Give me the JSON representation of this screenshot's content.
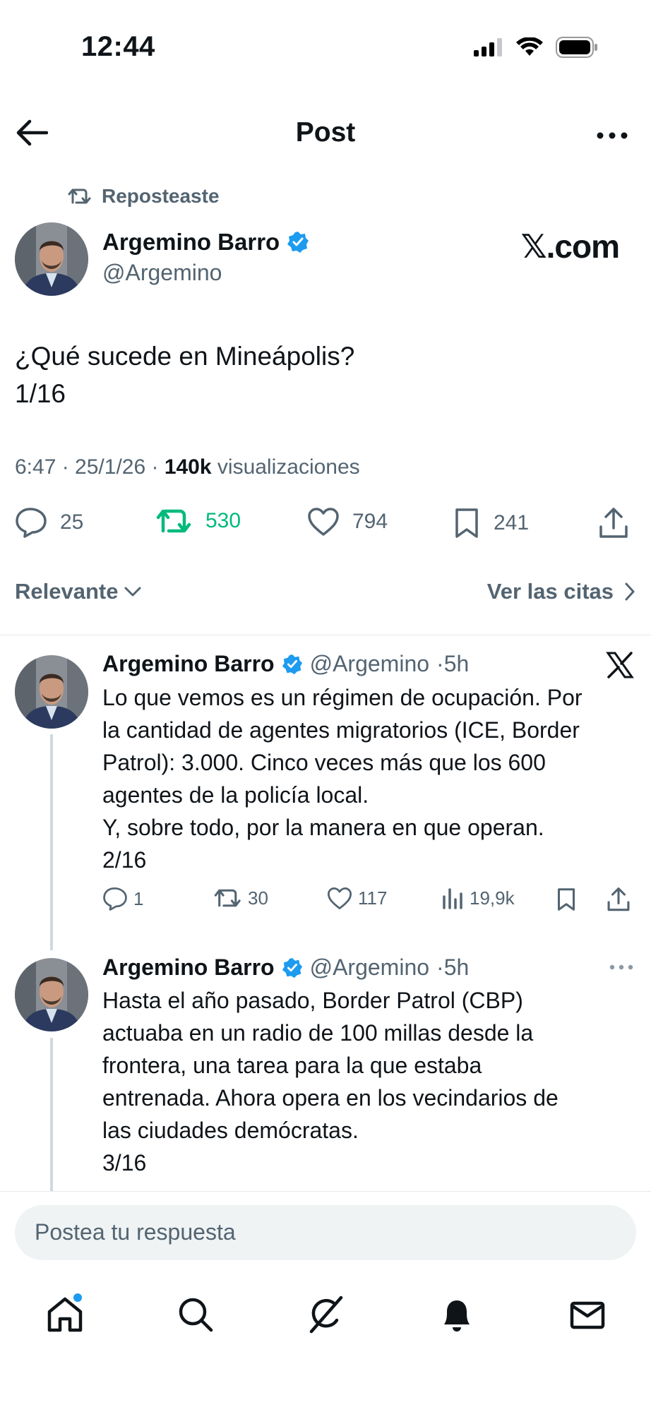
{
  "status_bar": {
    "time": "12:44"
  },
  "header": {
    "title": "Post"
  },
  "repost": {
    "label": "Reposteaste"
  },
  "post": {
    "author_name": "Argemino Barro",
    "author_handle": "@Argemino",
    "watermark": "𝕏.com",
    "text_line1": "¿Qué sucede en Mineápolis?",
    "text_line2": "1/16",
    "meta_time": "6:47 · 25/1/26 · ",
    "meta_views_count": "140k",
    "meta_views_label": " visualizaciones",
    "stats": {
      "replies": "25",
      "reposts": "530",
      "likes": "794",
      "bookmarks": "241"
    }
  },
  "sort": {
    "relevance_label": "Relevante",
    "quotes_label": "Ver las citas"
  },
  "replies": [
    {
      "name": "Argemino Barro",
      "handle": "@Argemino",
      "time": "·5h",
      "lines": [
        "Lo que vemos es un régimen de ocupación. Por",
        "la cantidad de agentes migratorios (ICE, Border",
        "Patrol): 3.000. Cinco veces más que los 600",
        "agentes de la policía local.",
        "Y, sobre todo, por la manera en que operan.",
        "2/16"
      ],
      "stats": {
        "replies": "1",
        "reposts": "30",
        "likes": "117",
        "views": "19,9k"
      }
    },
    {
      "name": "Argemino Barro",
      "handle": "@Argemino",
      "time": "·5h",
      "lines": [
        "Hasta el año pasado, Border Patrol (CBP)",
        "actuaba en un radio de 100 millas desde la",
        "frontera, una tarea para la que estaba",
        "entrenada. Ahora opera en los vecindarios de",
        "las ciudades demócratas.",
        "3/16"
      ]
    }
  ],
  "composer": {
    "placeholder": "Postea tu respuesta"
  },
  "colors": {
    "accent": "#1d9bf0",
    "repost_green": "#00ba7c",
    "muted": "#536471"
  },
  "icons": [
    "back-arrow-icon",
    "more-icon",
    "repost-icon",
    "verified-badge-icon",
    "reply-icon",
    "like-icon",
    "bookmark-icon",
    "share-icon",
    "views-icon",
    "x-logo-icon",
    "home-icon",
    "search-icon",
    "grok-icon",
    "notifications-icon",
    "messages-icon"
  ]
}
